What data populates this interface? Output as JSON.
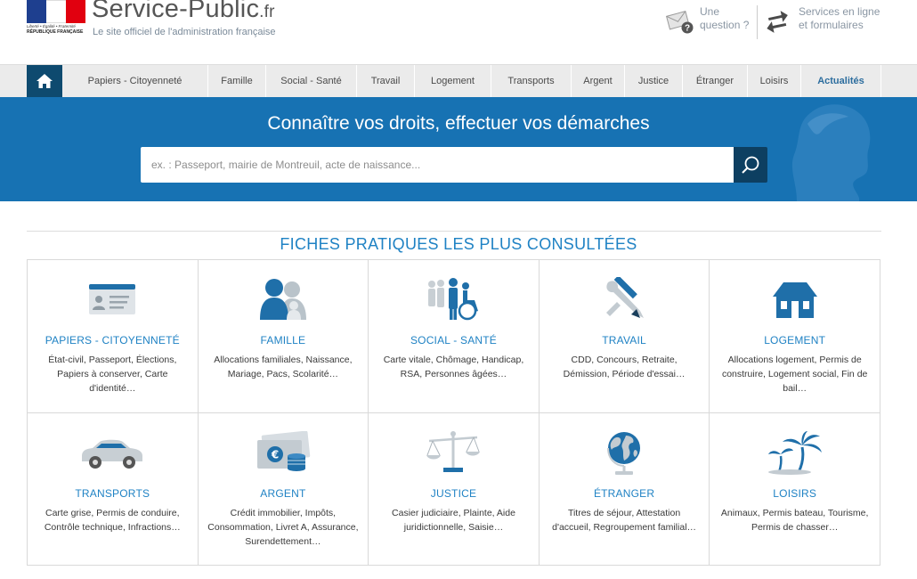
{
  "header": {
    "logo_motto": "Liberté • Égalité • Fraternité",
    "logo_rf": "RÉPUBLIQUE FRANÇAISE",
    "site_name": "Service-Public",
    "site_tld": ".fr",
    "site_subtitle": "Le site officiel de l'administration française",
    "question_line1": "Une",
    "question_line2": "question ?",
    "services_line1": "Services en ligne",
    "services_line2": "et formulaires"
  },
  "nav": {
    "home_icon": "home-icon",
    "items": [
      {
        "label": "Papiers - Citoyenneté"
      },
      {
        "label": "Famille"
      },
      {
        "label": "Social - Santé"
      },
      {
        "label": "Travail"
      },
      {
        "label": "Logement"
      },
      {
        "label": "Transports"
      },
      {
        "label": "Argent"
      },
      {
        "label": "Justice"
      },
      {
        "label": "Étranger"
      },
      {
        "label": "Loisirs"
      },
      {
        "label": "Actualités"
      }
    ]
  },
  "banner": {
    "title": "Connaître vos droits, effectuer vos démarches",
    "search_placeholder": "ex. : Passeport, mairie de Montreuil, acte de naissance...",
    "search_icon": "search-icon"
  },
  "section": {
    "title": "FICHES PRATIQUES LES PLUS CONSULTÉES"
  },
  "cards": [
    {
      "title": "PAPIERS - CITOYENNETÉ",
      "desc": "État-civil, Passeport, Élections, Papiers à conserver, Carte d'identité…",
      "icon": "id-card-icon"
    },
    {
      "title": "FAMILLE",
      "desc": "Allocations familiales, Naissance, Mariage, Pacs, Scolarité…",
      "icon": "family-icon"
    },
    {
      "title": "SOCIAL - SANTÉ",
      "desc": "Carte vitale, Chômage, Handicap, RSA, Personnes âgées…",
      "icon": "social-icon"
    },
    {
      "title": "TRAVAIL",
      "desc": "CDD, Concours, Retraite, Démission, Période d'essai…",
      "icon": "tools-icon"
    },
    {
      "title": "LOGEMENT",
      "desc": "Allocations logement, Permis de construire, Logement social, Fin de bail…",
      "icon": "house-icon"
    },
    {
      "title": "TRANSPORTS",
      "desc": "Carte grise, Permis de conduire, Contrôle technique, Infractions…",
      "icon": "car-icon"
    },
    {
      "title": "ARGENT",
      "desc": "Crédit immobilier, Impôts, Consommation, Livret A, Assurance, Surendettement…",
      "icon": "money-icon"
    },
    {
      "title": "JUSTICE",
      "desc": "Casier judiciaire, Plainte, Aide juridictionnelle, Saisie…",
      "icon": "scales-icon"
    },
    {
      "title": "ÉTRANGER",
      "desc": "Titres de séjour, Attestation d'accueil, Regroupement familial…",
      "icon": "globe-icon"
    },
    {
      "title": "LOISIRS",
      "desc": "Animaux, Permis bateau, Tourisme, Permis de chasser…",
      "icon": "palm-trees-icon"
    }
  ]
}
